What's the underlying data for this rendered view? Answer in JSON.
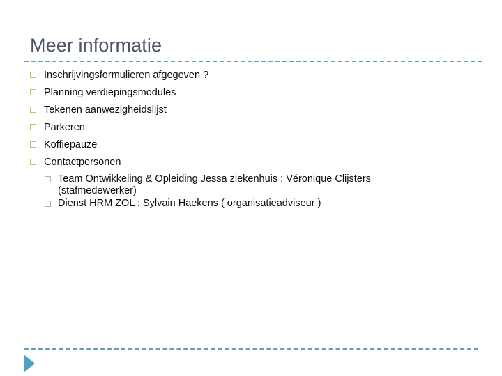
{
  "slide": {
    "title": "Meer informatie",
    "background_color": "#ffffff",
    "title_color": "#4d5566",
    "accent_color": "#5b9bb5",
    "triangle_color": "#4fa3bd",
    "bullet_marker_color": "#d4b95e",
    "sub_bullet_marker_color": "#9fb3c4",
    "body_text_color": "#0d0d0d"
  },
  "bullets": [
    {
      "text": "Inschrijvingsformulieren afgegeven ?"
    },
    {
      "text": "Planning verdiepingsmodules"
    },
    {
      "text": "Tekenen aanwezigheidslijst"
    },
    {
      "text": "Parkeren"
    },
    {
      "text": "Koffiepauze"
    },
    {
      "text": "Contactpersonen"
    }
  ],
  "sub_bullets": [
    {
      "text": "Team Ontwikkeling & Opleiding Jessa ziekenhuis : Véronique Clijsters (stafmedewerker)"
    },
    {
      "text": "Dienst HRM ZOL : Sylvain Haekens  ( organisatieadviseur )"
    }
  ],
  "icons": {
    "bullet_square": "hollow-square-bullet",
    "sub_bullet_square": "hollow-square-sub-bullet",
    "triangle": "play-triangle-accent"
  }
}
